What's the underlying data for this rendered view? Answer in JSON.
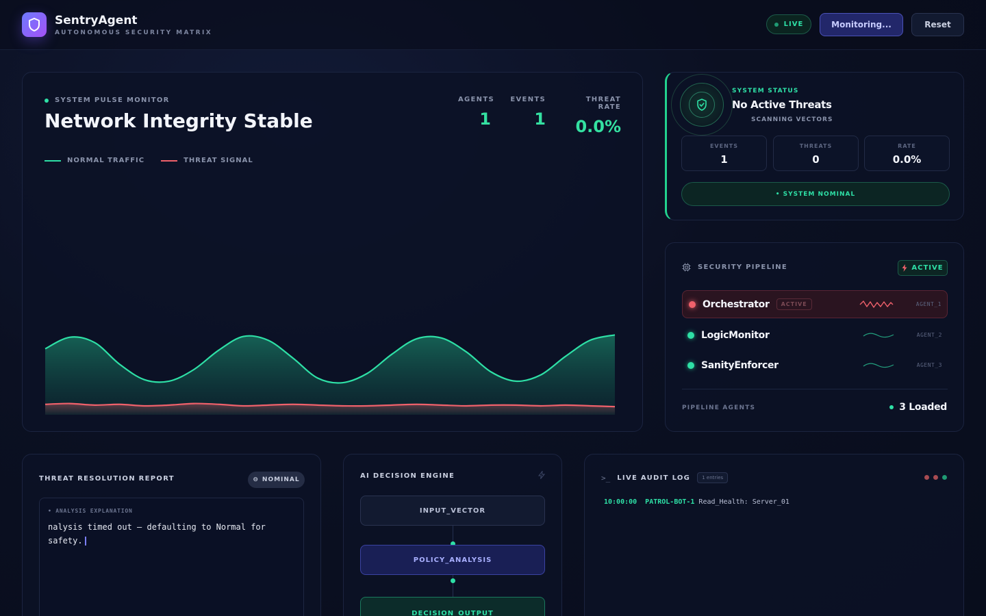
{
  "app": {
    "name": "SentryAgent",
    "subtitle": "AUTONOMOUS SECURITY MATRIX",
    "live_label": "LIVE",
    "monitor_label": "Monitoring...",
    "reset_label": "Reset"
  },
  "pulse": {
    "label": "SYSTEM PULSE MONITOR",
    "title": "Network Integrity Stable",
    "stats": [
      {
        "label": "AGENTS",
        "value": "1"
      },
      {
        "label": "EVENTS",
        "value": "1"
      },
      {
        "label": "THREAT RATE",
        "value": "0.0%"
      }
    ],
    "legend": [
      {
        "label": "NORMAL TRAFFIC",
        "color": "#2ee0a6"
      },
      {
        "label": "THREAT SIGNAL",
        "color": "#f0616b"
      }
    ]
  },
  "chart_data": {
    "type": "area",
    "grid": false,
    "series": [
      {
        "name": "NORMAL TRAFFIC",
        "color": "#2ee0a6",
        "values": [
          0.82,
          0.97,
          0.9,
          0.62,
          0.42,
          0.4,
          0.55,
          0.8,
          0.98,
          0.93,
          0.7,
          0.44,
          0.38,
          0.5,
          0.75,
          0.95,
          0.96,
          0.78,
          0.52,
          0.4,
          0.48,
          0.72,
          0.93,
          1.0
        ]
      },
      {
        "name": "THREAT SIGNAL",
        "color": "#f0616b",
        "values": [
          0.1,
          0.11,
          0.09,
          0.1,
          0.08,
          0.09,
          0.11,
          0.1,
          0.08,
          0.09,
          0.1,
          0.09,
          0.08,
          0.08,
          0.09,
          0.1,
          0.09,
          0.08,
          0.09,
          0.09,
          0.08,
          0.09,
          0.08,
          0.07
        ]
      }
    ],
    "ylim": [
      0,
      1.1
    ]
  },
  "status": {
    "label": "SYSTEM STATUS",
    "title": "No Active Threats",
    "sub": "SCANNING VECTORS",
    "boxes": [
      {
        "label": "EVENTS",
        "value": "1"
      },
      {
        "label": "THREATS",
        "value": "0"
      },
      {
        "label": "RATE",
        "value": "0.0%"
      }
    ],
    "nominal": "• SYSTEM NOMINAL"
  },
  "pipeline": {
    "title": "SECURITY PIPELINE",
    "active": "ACTIVE",
    "agents": [
      {
        "name": "Orchestrator",
        "badge": "ACTIVE",
        "id": "AGENT_1",
        "color": "#f0616b"
      },
      {
        "name": "LogicMonitor",
        "id": "AGENT_2",
        "color": "#2ee0a6"
      },
      {
        "name": "SanityEnforcer",
        "id": "AGENT_3",
        "color": "#2ee0a6"
      }
    ],
    "footer_label": "PIPELINE AGENTS",
    "footer_value": "3 Loaded"
  },
  "report": {
    "title": "THREAT RESOLUTION REPORT",
    "badge": "NOMINAL",
    "box_label": "• ANALYSIS EXPLANATION",
    "text": "nalysis timed out — defaulting to Normal for safety."
  },
  "ai": {
    "title": "AI DECISION ENGINE",
    "nodes": [
      "INPUT_VECTOR",
      "POLICY_ANALYSIS",
      "DECISION_OUTPUT"
    ]
  },
  "log": {
    "title": "LIVE AUDIT LOG",
    "count": "1 entries",
    "entries": [
      {
        "time": "10:00:00",
        "agent": "PATROL-BOT-1",
        "message": "Read_Health: Server_01"
      }
    ]
  }
}
